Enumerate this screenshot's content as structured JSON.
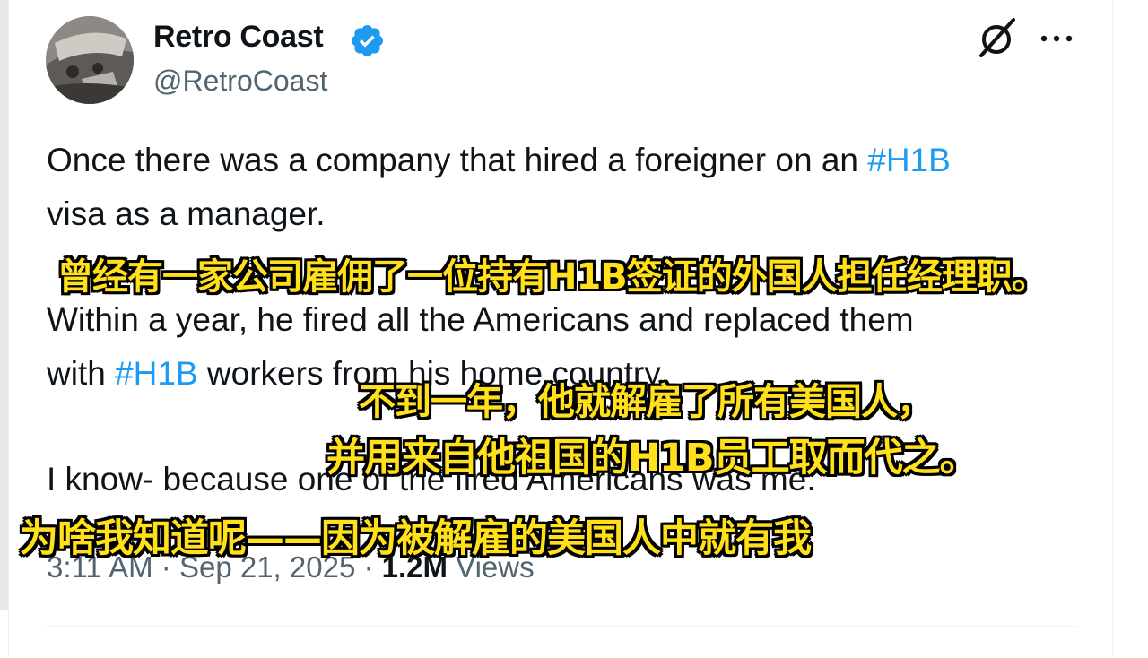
{
  "author": {
    "display_name": "Retro Coast",
    "handle": "@RetroCoast",
    "verified": true
  },
  "icons": {
    "grok": "grok-icon",
    "more": "more-options-icon",
    "verified": "verified-badge-icon",
    "accent_color": "#1d9bf0"
  },
  "tweet": {
    "line1_text": "Once there was a company that hired a foreigner on an ",
    "line1_hashtag": "#H1B",
    "line2": "visa as a manager.",
    "line3": "Within a year, he fired all the Americans and replaced them",
    "line4_prefix": "with ",
    "line4_hashtag": "#H1B",
    "line4_suffix": " workers from his home country.",
    "line5": "I know- because one of the fired Americans was me."
  },
  "meta": {
    "time": "3:11 AM",
    "separator": " · ",
    "date": "Sep 21, 2025",
    "views_count": "1.2M",
    "views_label": " Views"
  },
  "subtitles": {
    "line1": "曾经有一家公司雇佣了一位持有H1B签证的外国人担任经理职。",
    "line2a": "不到一年，他就解雇了所有美国人，",
    "line2b": "并用来自他祖国的H1B员工取而代之。",
    "line3": "为啥我知道呢——因为被解雇的美国人中就有我"
  }
}
